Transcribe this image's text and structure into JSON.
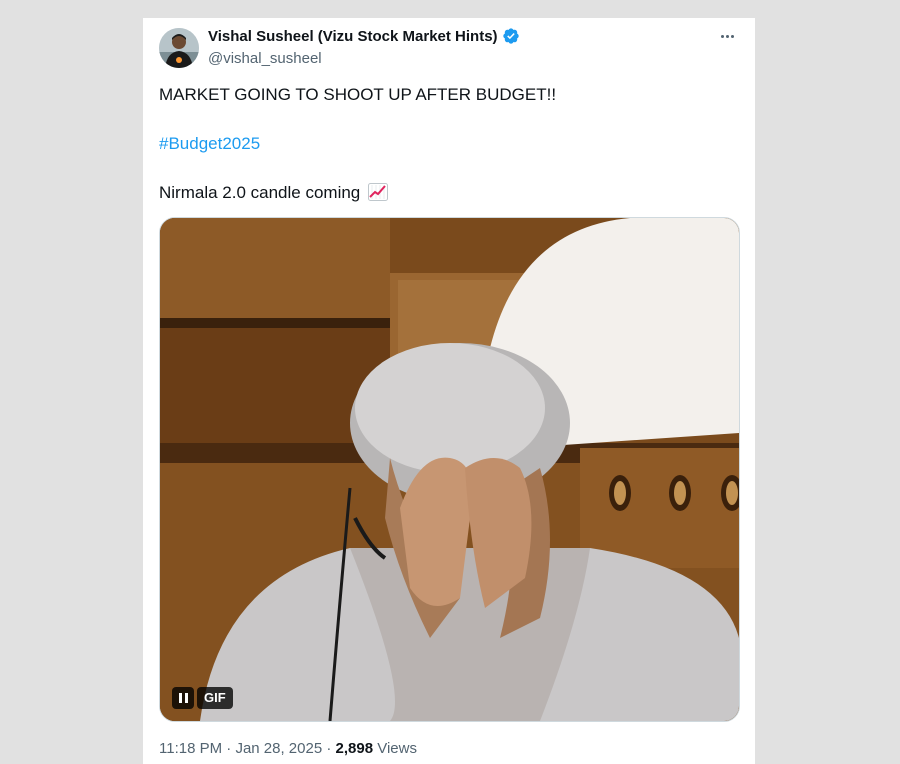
{
  "tweet": {
    "author_name": "Vishal Susheel (Vizu Stock Market Hints)",
    "handle": "@vishal_susheel",
    "verified": true,
    "lines": [
      "MARKET GOING TO SHOOT UP AFTER BUDGET!!",
      "#Budget2025",
      "Nirmala 2.0 candle coming"
    ],
    "emoji": "chart-increasing-icon",
    "media": {
      "type": "GIF",
      "badge": "GIF",
      "control": "pause-icon"
    },
    "time": "11:18 PM",
    "separator": " · ",
    "date": "Jan 28, 2025",
    "views_sep": " · ",
    "views_count": "2,898",
    "views_label": " Views"
  },
  "colors": {
    "link": "#1d9bf0",
    "verified": "#1d9bf0",
    "text": "#0f1419",
    "muted": "#536471"
  }
}
